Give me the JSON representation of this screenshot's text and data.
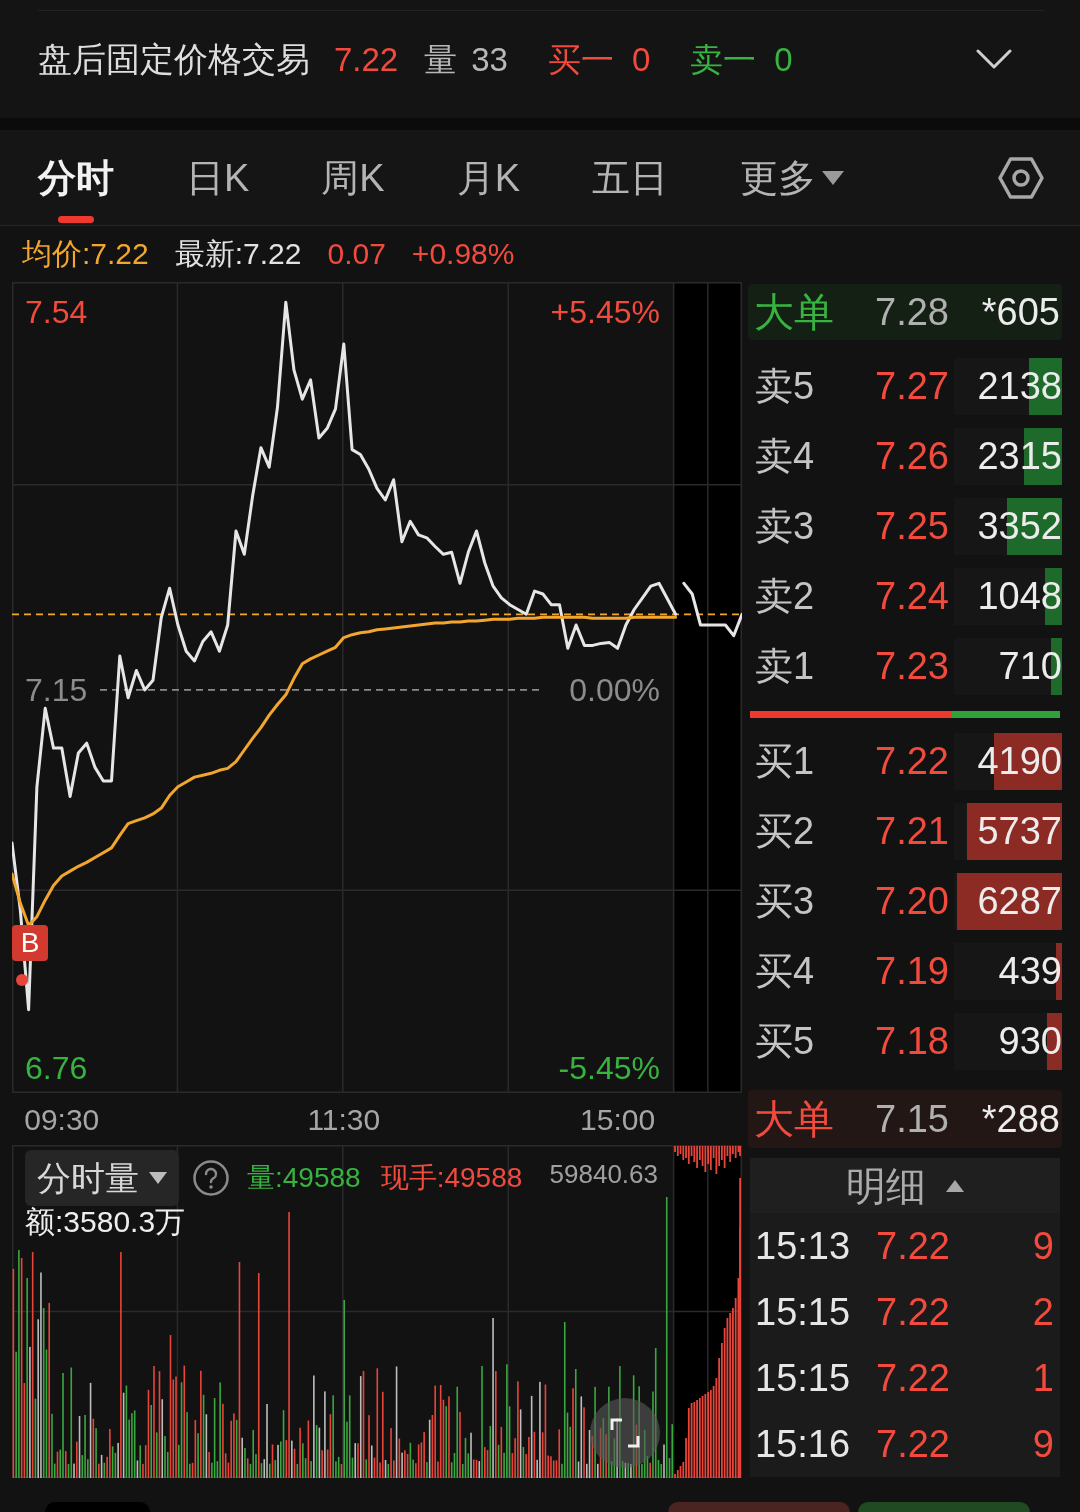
{
  "header": {
    "title": "盘后固定价格交易",
    "price": "7.22",
    "volume": {
      "label": "量",
      "value": "33"
    },
    "bid": {
      "label": "买一",
      "value": "0"
    },
    "ask": {
      "label": "卖一",
      "value": "0"
    }
  },
  "tabs": [
    {
      "label": "分时",
      "selected": true,
      "kind": "tab"
    },
    {
      "label": "日K",
      "selected": false,
      "kind": "tab"
    },
    {
      "label": "周K",
      "selected": false,
      "kind": "tab"
    },
    {
      "label": "月K",
      "selected": false,
      "kind": "tab"
    },
    {
      "label": "五日",
      "selected": false,
      "kind": "tab"
    },
    {
      "label": "更多",
      "selected": false,
      "kind": "menu"
    }
  ],
  "quote": {
    "average": "均价:7.22",
    "latest": "最新:7.22",
    "change": "0.07",
    "change_percent": "+0.98%"
  },
  "price_chart": {
    "percent_labels": [
      "+5.45%",
      "0.00%",
      "-5.45%"
    ],
    "chart_data": {
      "type": "line",
      "categories": [
        null,
        null,
        null,
        null,
        null,
        null,
        "09:30",
        null,
        null,
        null,
        null,
        null,
        null,
        null,
        null,
        null,
        null,
        null,
        null,
        null,
        null,
        null,
        null,
        null,
        null,
        null,
        null,
        null,
        null,
        null,
        null,
        null,
        null,
        null,
        null,
        null,
        null,
        null,
        null,
        null,
        "11:30",
        null,
        null,
        null,
        null,
        null,
        null,
        null,
        null,
        null,
        null,
        null,
        null,
        null,
        null,
        null,
        null,
        null,
        null,
        null,
        null,
        null,
        null,
        null,
        null,
        null,
        null,
        null,
        null,
        null,
        null,
        null,
        null,
        "15:00",
        null,
        null,
        null,
        null,
        null,
        null,
        null,
        null,
        null,
        null,
        null,
        null,
        null,
        null,
        null
      ],
      "ylim": [
        6.734,
        7.571
      ],
      "yticks": [
        {
          "value": 7.54,
          "label": "7.54"
        },
        {
          "value": 7.15,
          "label": "7.15"
        },
        {
          "value": 6.76,
          "label": "6.76"
        }
      ],
      "series": [
        {
          "color": "#e6e6e6",
          "values": [
            6.992,
            6.923,
            6.82,
            7.05,
            7.131,
            7.09,
            7.09,
            7.04,
            7.085,
            7.095,
            7.07,
            7.056,
            7.056,
            7.185,
            7.142,
            7.17,
            7.15,
            7.16,
            7.225,
            7.255,
            7.217,
            7.19,
            7.18,
            7.2,
            7.21,
            7.19,
            7.217,
            7.314,
            7.29,
            7.35,
            7.4,
            7.38,
            7.442,
            7.55,
            7.48,
            7.45,
            7.47,
            7.41,
            7.42,
            7.44,
            7.507,
            7.398,
            7.393,
            7.378,
            7.358,
            7.346,
            7.367,
            7.303,
            7.324,
            7.31,
            7.307,
            7.298,
            7.29,
            7.292,
            7.26,
            7.292,
            7.314,
            7.281,
            7.257,
            7.245,
            7.238,
            7.233,
            7.228,
            7.252,
            7.249,
            7.238,
            7.238,
            7.193,
            7.217,
            7.196,
            7.196,
            7.198,
            7.199,
            7.193,
            7.217,
            7.233,
            7.245,
            7.257,
            7.26,
            7.244,
            7.228,
            7.26,
            7.249,
            7.217,
            7.217,
            7.217,
            7.217,
            7.206,
            7.228
          ]
        },
        {
          "color": "#f2a62e",
          "values": [
            6.96,
            6.93,
            6.907,
            6.916,
            6.933,
            6.948,
            6.958,
            6.963,
            6.968,
            6.972,
            6.977,
            6.982,
            6.987,
            7.0,
            7.012,
            7.015,
            7.018,
            7.022,
            7.028,
            7.041,
            7.05,
            7.055,
            7.06,
            7.062,
            7.064,
            7.067,
            7.069,
            7.076,
            7.088,
            7.1,
            7.111,
            7.124,
            7.135,
            7.145,
            7.162,
            7.177,
            7.182,
            7.186,
            7.19,
            7.194,
            7.204,
            7.207,
            7.209,
            7.21,
            7.212,
            7.213,
            7.214,
            7.215,
            7.216,
            7.217,
            7.218,
            7.219,
            7.219,
            7.22,
            7.22,
            7.221,
            7.221,
            7.222,
            7.223,
            7.223,
            7.223,
            7.224,
            7.224,
            7.224,
            7.225,
            7.225,
            7.225,
            7.225,
            7.225,
            7.225,
            7.224,
            7.224,
            7.224,
            7.224,
            7.224,
            7.225,
            7.225,
            7.225,
            7.225,
            7.225,
            7.225,
            null,
            null,
            null,
            null,
            null,
            null,
            null,
            null
          ]
        }
      ],
      "ref_lines": [
        {
          "axis": "y",
          "value": 7.15,
          "color": "#8a8a8a"
        },
        {
          "axis": "y",
          "value": 7.228,
          "color": "#f2a62e"
        }
      ],
      "annotations": [
        "B"
      ]
    }
  },
  "volume_chart": {
    "selector": "分时量",
    "volume": "量:49588",
    "current_hand": "现手:49588",
    "amount": "额:3580.3万",
    "max_label": "59840.63"
  },
  "order_book": {
    "big_order_top": {
      "kind": "sell",
      "label": "大单",
      "price": "7.28",
      "volume": "*605"
    },
    "asks": [
      {
        "label": "卖5",
        "price": "7.27",
        "volume": "2138",
        "level": 0.31
      },
      {
        "label": "卖4",
        "price": "7.26",
        "volume": "2315",
        "level": 0.35
      },
      {
        "label": "卖3",
        "price": "7.25",
        "volume": "3352",
        "level": 0.51
      },
      {
        "label": "卖2",
        "price": "7.24",
        "volume": "1048",
        "level": 0.16
      },
      {
        "label": "卖1",
        "price": "7.23",
        "volume": "710",
        "level": 0.1
      }
    ],
    "ratio_bar": {
      "level": 0.65
    },
    "bids": [
      {
        "label": "买1",
        "price": "7.22",
        "volume": "4190",
        "level": 0.63
      },
      {
        "label": "买2",
        "price": "7.21",
        "volume": "5737",
        "level": 0.88
      },
      {
        "label": "买3",
        "price": "7.20",
        "volume": "6287",
        "level": 0.97
      },
      {
        "label": "买4",
        "price": "7.19",
        "volume": "439",
        "level": 0.06
      },
      {
        "label": "买5",
        "price": "7.18",
        "volume": "930",
        "level": 0.14
      }
    ],
    "big_order_bottom": {
      "kind": "buy",
      "label": "大单",
      "price": "7.15",
      "volume": "*288"
    }
  },
  "details": {
    "title": "明细",
    "rows": [
      {
        "time": "15:13",
        "price": "7.22",
        "volume": "9"
      },
      {
        "time": "15:15",
        "price": "7.22",
        "volume": "2"
      },
      {
        "time": "15:15",
        "price": "7.22",
        "volume": "1"
      },
      {
        "time": "15:16",
        "price": "7.22",
        "volume": "9"
      }
    ]
  }
}
